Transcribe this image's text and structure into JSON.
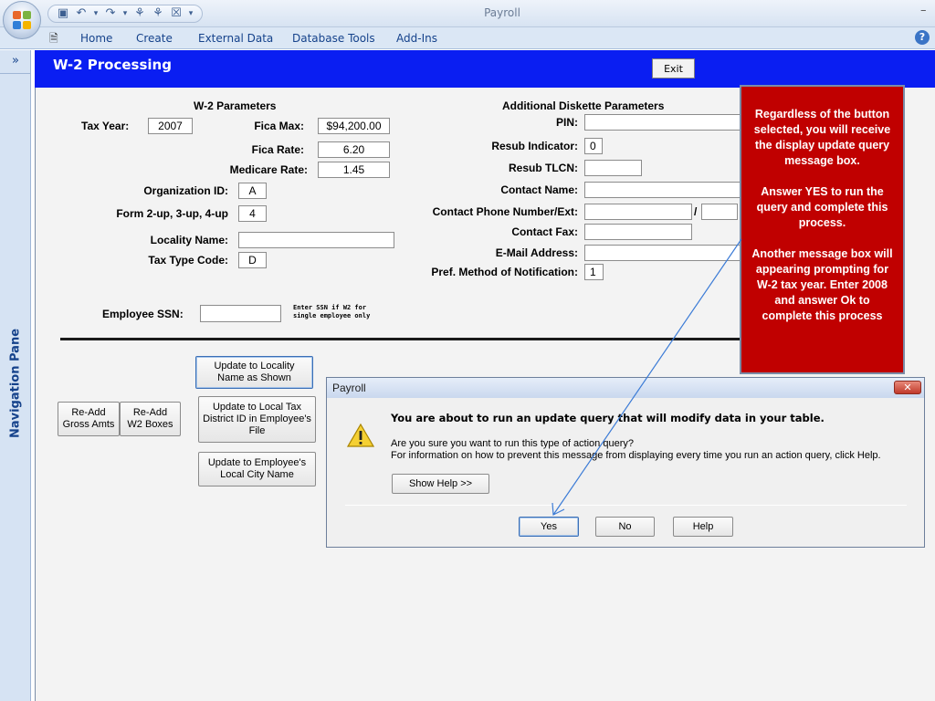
{
  "titlebar": {
    "app_title": "Payroll",
    "min_glyph": "–"
  },
  "qat": {
    "icons": [
      "save-icon",
      "undo-icon",
      "redo-icon",
      "relationships-icon",
      "relationships-icon",
      "close-icon",
      "customize-icon"
    ]
  },
  "ribbon": {
    "tabs": [
      "Home",
      "Create",
      "External Data",
      "Database Tools",
      "Add-Ins"
    ],
    "help_glyph": "?"
  },
  "nav": {
    "toggle": "»",
    "label": "Navigation Pane"
  },
  "form": {
    "title": "W-2 Processing",
    "exit_label": "Exit",
    "w2_header": "W-2 Parameters",
    "tax_year_label": "Tax Year:",
    "tax_year": "2007",
    "fica_max_label": "Fica Max:",
    "fica_max": "$94,200.00",
    "fica_rate_label": "Fica Rate:",
    "fica_rate": "6.20",
    "medicare_rate_label": "Medicare Rate:",
    "medicare_rate": "1.45",
    "org_id_label": "Organization ID:",
    "org_id": "A",
    "form_up_label": "Form 2-up, 3-up, 4-up",
    "form_up": "4",
    "locality_name_label": "Locality Name:",
    "locality_name": "",
    "tax_type_label": "Tax Type Code:",
    "tax_type": "D",
    "employee_ssn_label": "Employee SSN:",
    "employee_ssn": "",
    "ssn_hint_1": "Enter SSN if W2 for",
    "ssn_hint_2": "single employee only",
    "additional_header": "Additional Diskette Parameters",
    "pin_label": "PIN:",
    "pin": "",
    "resub_indicator_label": "Resub Indicator:",
    "resub_indicator": "0",
    "resub_tlcn_label": "Resub TLCN:",
    "resub_tlcn": "",
    "contact_name_label": "Contact Name:",
    "contact_name": "",
    "contact_phone_label": "Contact Phone Number/Ext:",
    "contact_phone": "",
    "phone_sep": "/",
    "contact_ext": "",
    "contact_fax_label": "Contact Fax:",
    "contact_fax": "",
    "email_label": "E-Mail Address:",
    "email": "",
    "pref_method_label": "Pref. Method of Notification:",
    "pref_method": "1"
  },
  "buttons": {
    "update_locality_1": "Update to Locality",
    "update_locality_2": "Name as Shown",
    "update_tax_district_1": "Update to Local Tax",
    "update_tax_district_2": "District ID in Employee's",
    "update_tax_district_3": "File",
    "update_city_1": "Update to Employee's",
    "update_city_2": "Local City Name",
    "readd_gross_1": "Re-Add",
    "readd_gross_2": "Gross Amts",
    "readd_w2_1": "Re-Add",
    "readd_w2_2": "W2 Boxes"
  },
  "callout": {
    "p1": "Regardless of the button selected, you will receive the display update query message box.",
    "p2": "Answer YES to run the query and complete this process.",
    "p3": "Another message box will appearing prompting for W-2 tax year. Enter 2008 and answer Ok to complete this process"
  },
  "dialog": {
    "title": "Payroll",
    "close_glyph": "✕",
    "message": "You are about to run an update query that will modify data in your table.",
    "question": "Are you sure you want to run this type of action query?",
    "info": "For information on how to prevent this message from displaying every time you run an action query, click Help.",
    "show_help": "Show Help >>",
    "yes": "Yes",
    "no": "No",
    "help": "Help"
  },
  "colors": {
    "header_blue": "#0a1ef2",
    "callout_red": "#c00000",
    "arrow_blue": "#3b7bd6"
  }
}
